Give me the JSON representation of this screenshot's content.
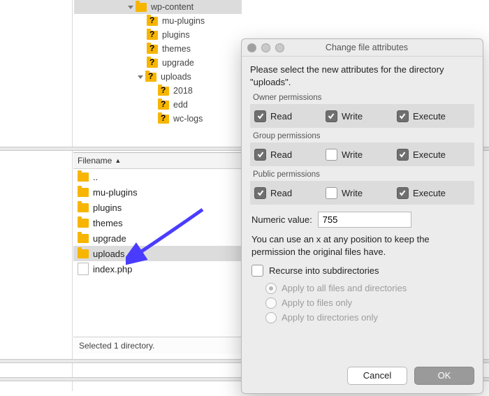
{
  "tree": {
    "root": "wp-content",
    "items": [
      {
        "label": "mu-plugins"
      },
      {
        "label": "plugins"
      },
      {
        "label": "themes"
      },
      {
        "label": "upgrade"
      },
      {
        "label": "uploads",
        "expanded": true,
        "children": [
          {
            "label": "2018"
          },
          {
            "label": "edd"
          },
          {
            "label": "wc-logs"
          }
        ]
      }
    ]
  },
  "filelist": {
    "header": "Filename",
    "rows": [
      {
        "label": "..",
        "type": "folder"
      },
      {
        "label": "mu-plugins",
        "type": "folder"
      },
      {
        "label": "plugins",
        "type": "folder"
      },
      {
        "label": "themes",
        "type": "folder"
      },
      {
        "label": "upgrade",
        "type": "folder"
      },
      {
        "label": "uploads",
        "type": "folder",
        "selected": true
      },
      {
        "label": "index.php",
        "type": "file"
      }
    ],
    "status": "Selected 1 directory."
  },
  "dialog": {
    "title": "Change file attributes",
    "instruction": "Please select the new attributes for the directory \"uploads\".",
    "groups": [
      {
        "title": "Owner permissions",
        "read": true,
        "write": true,
        "execute": true
      },
      {
        "title": "Group permissions",
        "read": true,
        "write": false,
        "execute": true
      },
      {
        "title": "Public permissions",
        "read": true,
        "write": false,
        "execute": true
      }
    ],
    "perm_labels": {
      "read": "Read",
      "write": "Write",
      "execute": "Execute"
    },
    "numeric_label": "Numeric value:",
    "numeric_value": "755",
    "note": "You can use an x at any position to keep the permission the original files have.",
    "recurse_label": "Recurse into subdirectories",
    "recurse_checked": false,
    "radios": [
      {
        "label": "Apply to all files and directories",
        "selected": true
      },
      {
        "label": "Apply to files only",
        "selected": false
      },
      {
        "label": "Apply to directories only",
        "selected": false
      }
    ],
    "buttons": {
      "cancel": "Cancel",
      "ok": "OK"
    }
  }
}
